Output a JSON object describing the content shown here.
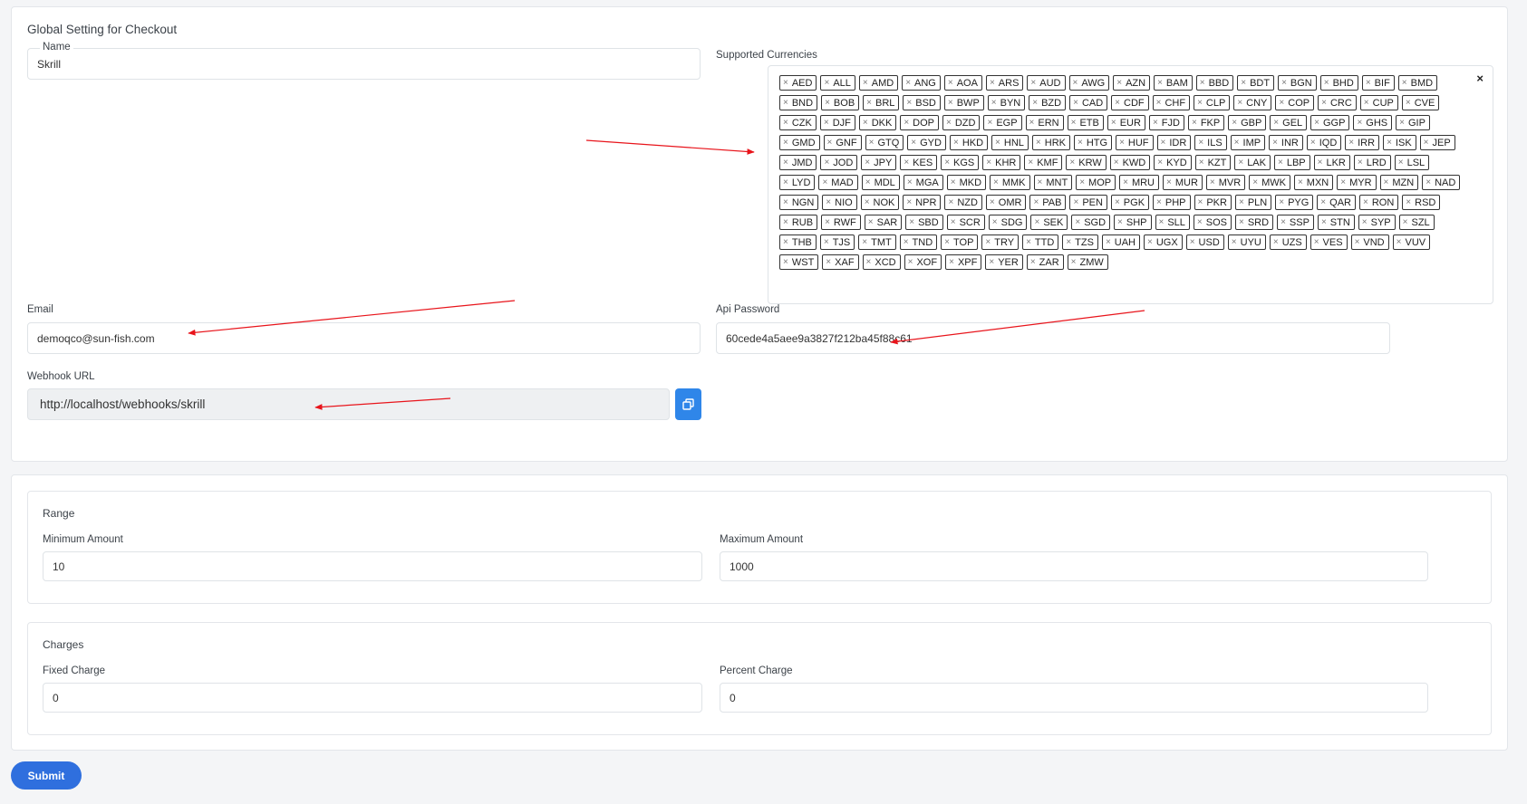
{
  "form": {
    "title": "Global Setting for Checkout",
    "name_label": "Name",
    "name_value": "Skrill",
    "currencies_label": "Supported Currencies",
    "clear_all": "×",
    "tag_remove": "×",
    "currencies": [
      "AED",
      "ALL",
      "AMD",
      "ANG",
      "AOA",
      "ARS",
      "AUD",
      "AWG",
      "AZN",
      "BAM",
      "BBD",
      "BDT",
      "BGN",
      "BHD",
      "BIF",
      "BMD",
      "BND",
      "BOB",
      "BRL",
      "BSD",
      "BWP",
      "BYN",
      "BZD",
      "CAD",
      "CDF",
      "CHF",
      "CLP",
      "CNY",
      "COP",
      "CRC",
      "CUP",
      "CVE",
      "CZK",
      "DJF",
      "DKK",
      "DOP",
      "DZD",
      "EGP",
      "ERN",
      "ETB",
      "EUR",
      "FJD",
      "FKP",
      "GBP",
      "GEL",
      "GGP",
      "GHS",
      "GIP",
      "GMD",
      "GNF",
      "GTQ",
      "GYD",
      "HKD",
      "HNL",
      "HRK",
      "HTG",
      "HUF",
      "IDR",
      "ILS",
      "IMP",
      "INR",
      "IQD",
      "IRR",
      "ISK",
      "JEP",
      "JMD",
      "JOD",
      "JPY",
      "KES",
      "KGS",
      "KHR",
      "KMF",
      "KRW",
      "KWD",
      "KYD",
      "KZT",
      "LAK",
      "LBP",
      "LKR",
      "LRD",
      "LSL",
      "LYD",
      "MAD",
      "MDL",
      "MGA",
      "MKD",
      "MMK",
      "MNT",
      "MOP",
      "MRU",
      "MUR",
      "MVR",
      "MWK",
      "MXN",
      "MYR",
      "MZN",
      "NAD",
      "NGN",
      "NIO",
      "NOK",
      "NPR",
      "NZD",
      "OMR",
      "PAB",
      "PEN",
      "PGK",
      "PHP",
      "PKR",
      "PLN",
      "PYG",
      "QAR",
      "RON",
      "RSD",
      "RUB",
      "RWF",
      "SAR",
      "SBD",
      "SCR",
      "SDG",
      "SEK",
      "SGD",
      "SHP",
      "SLL",
      "SOS",
      "SRD",
      "SSP",
      "STN",
      "SYP",
      "SZL",
      "THB",
      "TJS",
      "TMT",
      "TND",
      "TOP",
      "TRY",
      "TTD",
      "TZS",
      "UAH",
      "UGX",
      "USD",
      "UYU",
      "UZS",
      "VES",
      "VND",
      "VUV",
      "WST",
      "XAF",
      "XCD",
      "XOF",
      "XPF",
      "YER",
      "ZAR",
      "ZMW"
    ],
    "email_label": "Email",
    "email_value": "demoqco@sun-fish.com",
    "api_password_label": "Api Password",
    "api_password_value": "60cede4a5aee9a3827f212ba45f88c61",
    "webhook_label": "Webhook URL",
    "webhook_value": "http://localhost/webhooks/skrill",
    "copy_icon": "copy-icon"
  },
  "range": {
    "title": "Range",
    "min_label": "Minimum Amount",
    "min_value": "10",
    "max_label": "Maximum Amount",
    "max_value": "1000"
  },
  "charges": {
    "title": "Charges",
    "fixed_label": "Fixed Charge",
    "fixed_value": "0",
    "percent_label": "Percent Charge",
    "percent_value": "0"
  },
  "submit_label": "Submit",
  "colors": {
    "accent": "#2f6fde",
    "copy_button": "#2f86e9",
    "annotation_arrow": "#e8141b"
  }
}
